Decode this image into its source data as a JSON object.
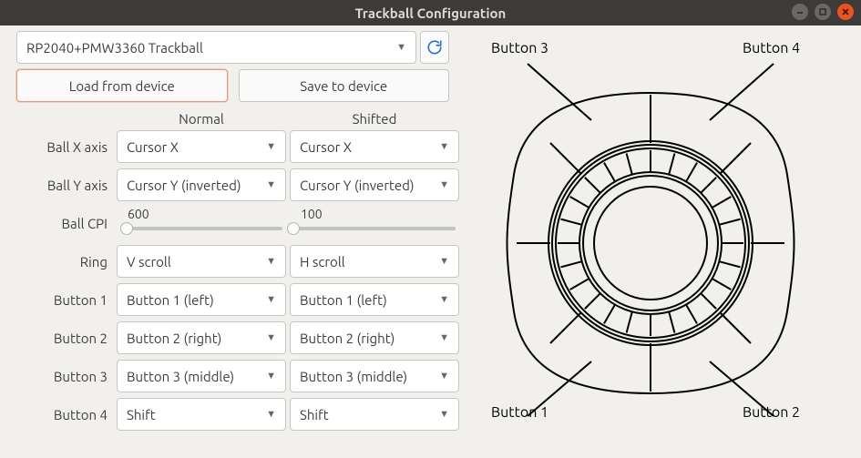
{
  "window": {
    "title": "Trackball Configuration"
  },
  "device": {
    "selected": "RP2040+PMW3360 Trackball",
    "load_label": "Load from device",
    "save_label": "Save to device"
  },
  "columns": {
    "normal": "Normal",
    "shifted": "Shifted"
  },
  "rows": {
    "ball_x": {
      "label": "Ball X axis",
      "normal": "Cursor X",
      "shifted": "Cursor X"
    },
    "ball_y": {
      "label": "Ball Y axis",
      "normal": "Cursor Y (inverted)",
      "shifted": "Cursor Y (inverted)"
    },
    "cpi": {
      "label": "Ball CPI",
      "normal": "600",
      "shifted": "100"
    },
    "ring": {
      "label": "Ring",
      "normal": "V scroll",
      "shifted": "H scroll"
    },
    "b1": {
      "label": "Button 1",
      "normal": "Button 1 (left)",
      "shifted": "Button 1 (left)"
    },
    "b2": {
      "label": "Button 2",
      "normal": "Button 2 (right)",
      "shifted": "Button 2 (right)"
    },
    "b3": {
      "label": "Button 3",
      "normal": "Button 3 (middle)",
      "shifted": "Button 3 (middle)"
    },
    "b4": {
      "label": "Button 4",
      "normal": "Shift",
      "shifted": "Shift"
    }
  },
  "diagram": {
    "b1": "Button 1",
    "b2": "Button 2",
    "b3": "Button 3",
    "b4": "Button 4"
  }
}
